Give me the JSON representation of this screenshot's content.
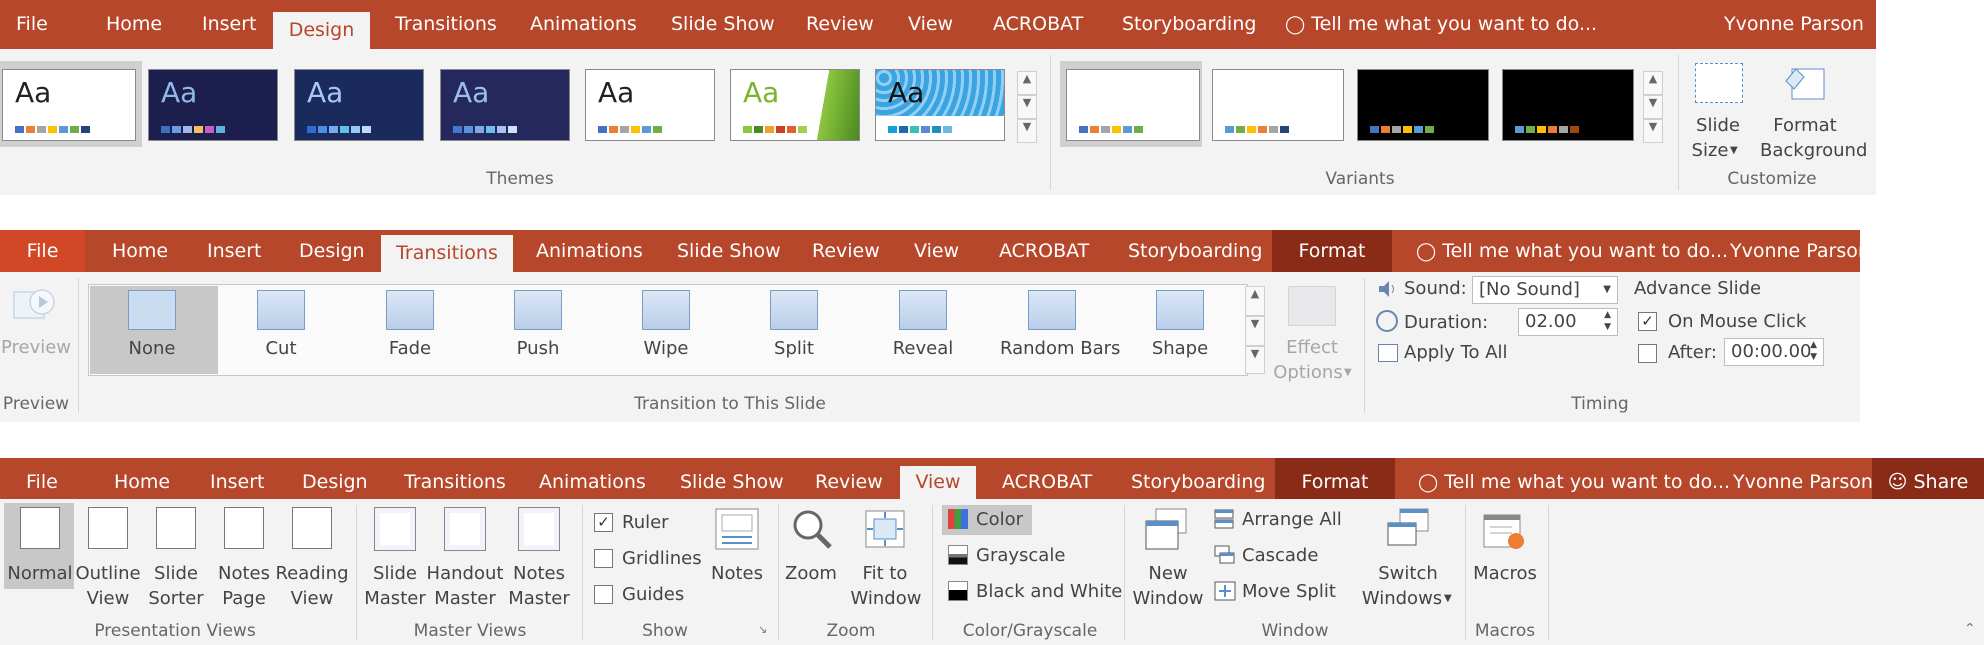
{
  "strip1": {
    "tabs": [
      "File",
      "Home",
      "Insert",
      "Design",
      "Transitions",
      "Animations",
      "Slide Show",
      "Review",
      "View",
      "ACROBAT",
      "Storyboarding"
    ],
    "tell_me": "Tell me what you want to do...",
    "user": "Yvonne Parson",
    "theme_sample": "Aa",
    "groups": {
      "themes": "Themes",
      "variants": "Variants",
      "customize": "Customize"
    },
    "slide_size": [
      "Slide",
      "Size"
    ],
    "format_background": [
      "Format",
      "Background"
    ]
  },
  "strip2": {
    "tabs": [
      "File",
      "Home",
      "Insert",
      "Design",
      "Transitions",
      "Animations",
      "Slide Show",
      "Review",
      "View",
      "ACROBAT",
      "Storyboarding"
    ],
    "format_tab": "Format",
    "tell_me": "Tell me what you want to do...",
    "user": "Yvonne Parson",
    "preview": "Preview",
    "transitions": [
      "None",
      "Cut",
      "Fade",
      "Push",
      "Wipe",
      "Split",
      "Reveal",
      "Random Bars",
      "Shape"
    ],
    "effect_options": [
      "Effect",
      "Options"
    ],
    "sound_label": "Sound:",
    "sound_value": "[No Sound]",
    "duration_label": "Duration:",
    "duration_value": "02.00",
    "apply_all": "Apply To All",
    "advance_slide": "Advance Slide",
    "on_mouse_click": "On Mouse Click",
    "after_label": "After:",
    "after_value": "00:00.00",
    "groups": {
      "preview": "Preview",
      "transition": "Transition to This Slide",
      "timing": "Timing"
    }
  },
  "strip3": {
    "tabs": [
      "File",
      "Home",
      "Insert",
      "Design",
      "Transitions",
      "Animations",
      "Slide Show",
      "Review",
      "View",
      "ACROBAT",
      "Storyboarding"
    ],
    "format_tab": "Format",
    "tell_me": "Tell me what you want to do...",
    "user": "Yvonne Parson",
    "share": "Share",
    "pres_views": [
      [
        "Normal",
        ""
      ],
      [
        "Outline",
        "View"
      ],
      [
        "Slide",
        "Sorter"
      ],
      [
        "Notes",
        "Page"
      ],
      [
        "Reading",
        "View"
      ]
    ],
    "master_views": [
      [
        "Slide",
        "Master"
      ],
      [
        "Handout",
        "Master"
      ],
      [
        "Notes",
        "Master"
      ]
    ],
    "show": {
      "ruler": "Ruler",
      "gridlines": "Gridlines",
      "guides": "Guides",
      "notes": "Notes"
    },
    "zoom": {
      "zoom": "Zoom",
      "fit": [
        "Fit to",
        "Window"
      ]
    },
    "color": {
      "color": "Color",
      "grayscale": "Grayscale",
      "bw": "Black and White"
    },
    "window": {
      "new": [
        "New",
        "Window"
      ],
      "arrange": "Arrange All",
      "cascade": "Cascade",
      "move_split": "Move Split",
      "switch": [
        "Switch",
        "Windows"
      ]
    },
    "macros": "Macros",
    "groups": {
      "pres": "Presentation Views",
      "master": "Master Views",
      "show": "Show",
      "zoom": "Zoom",
      "color": "Color/Grayscale",
      "window": "Window",
      "macros": "Macros"
    }
  }
}
